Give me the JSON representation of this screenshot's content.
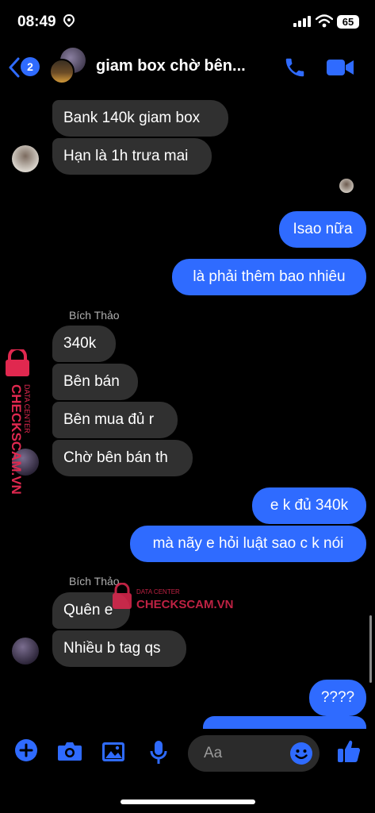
{
  "status_bar": {
    "time": "08:49",
    "battery": "65"
  },
  "header": {
    "back_count": "2",
    "title": "giam box chờ bên..."
  },
  "messages": [
    {
      "dir": "in",
      "text": "Bank 140k giam box"
    },
    {
      "dir": "in",
      "text": "Hạn là 1h trưa mai"
    },
    {
      "dir": "out",
      "text": "Isao nữa"
    },
    {
      "dir": "out",
      "text": "là phải thêm bao nhiêu"
    },
    {
      "dir": "in",
      "text": "340k"
    },
    {
      "dir": "in",
      "text": "Bên bán"
    },
    {
      "dir": "in",
      "text": "Bên mua đủ r"
    },
    {
      "dir": "in",
      "text": "Chờ bên bán th"
    },
    {
      "dir": "out",
      "text": "e k đủ 340k"
    },
    {
      "dir": "out",
      "text": "mà nãy e hỏi luật sao c k nói"
    },
    {
      "dir": "in",
      "text": "Quên e"
    },
    {
      "dir": "in",
      "text": "Nhiều b tag qs"
    },
    {
      "dir": "out",
      "text": "????"
    }
  ],
  "senders": [
    "Bích Thảo",
    "Bích Thảo"
  ],
  "composer": {
    "placeholder": "Aa"
  },
  "watermark": {
    "line1": "DATA CENTER",
    "line2": "CHECKSCAM.VN"
  },
  "colors": {
    "accent": "#2f6bff",
    "incoming_bubble": "#303030",
    "watermark": "#e0284f"
  }
}
